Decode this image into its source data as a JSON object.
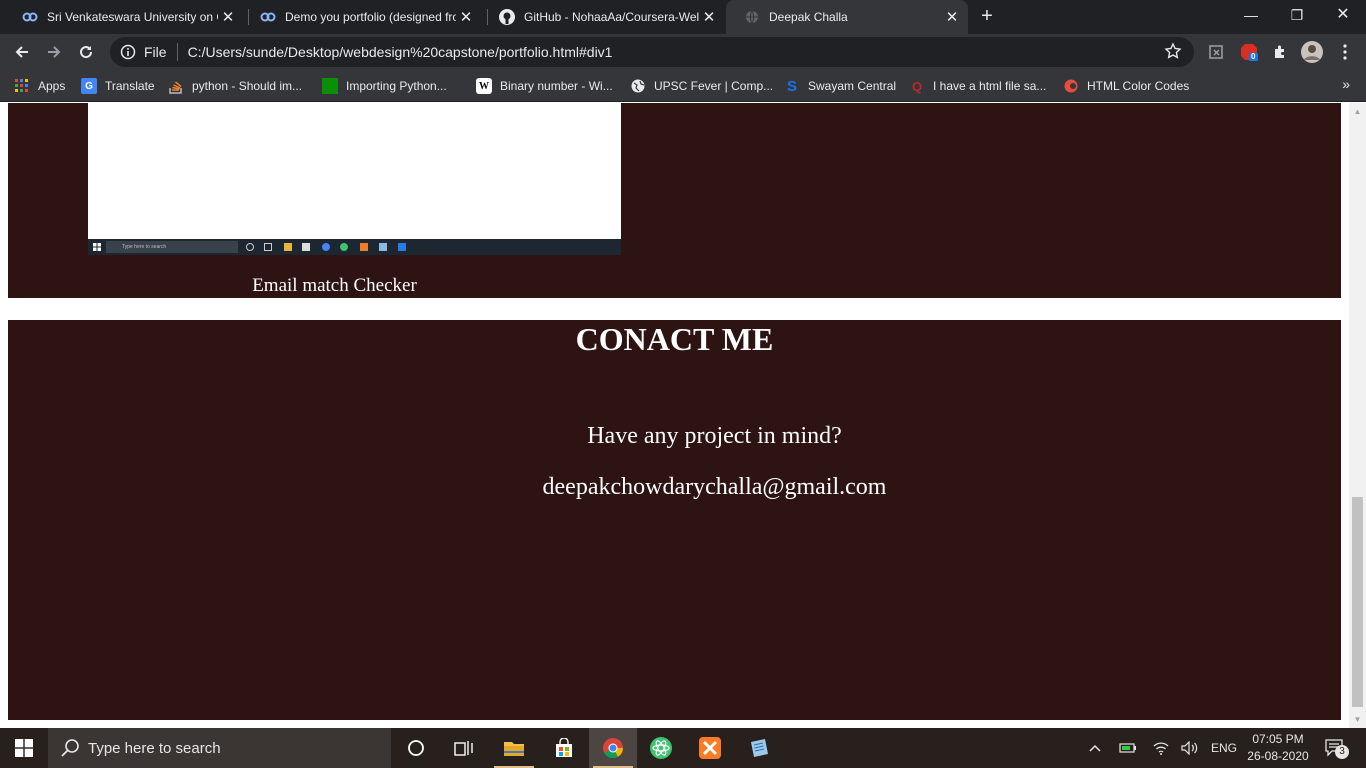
{
  "browser": {
    "tabs": [
      {
        "title": "Sri Venkateswara University on Co",
        "favicon": "coursera-icon",
        "active": false
      },
      {
        "title": "Demo you portfolio (designed fro",
        "favicon": "coursera-icon",
        "active": false
      },
      {
        "title": "GitHub - NohaaAa/Coursera-Wel",
        "favicon": "github-icon",
        "active": false
      },
      {
        "title": "Deepak Challa",
        "favicon": "globe-icon",
        "active": true
      }
    ],
    "new_tab_label": "+",
    "omnibox": {
      "scheme": "File",
      "url": "C:/Users/sunde/Desktop/webdesign%20capstone/portfolio.html#div1"
    },
    "extension_badge": "0",
    "bookmarks": [
      {
        "label": "Apps",
        "icon": "apps-grid-icon"
      },
      {
        "label": "Translate",
        "icon": "google-translate-icon"
      },
      {
        "label": "python - Should im...",
        "icon": "stackoverflow-icon"
      },
      {
        "label": "Importing Python...",
        "icon": "green-square-icon"
      },
      {
        "label": "Binary number - Wi...",
        "icon": "wikipedia-icon"
      },
      {
        "label": "UPSC Fever | Comp...",
        "icon": "globe-icon"
      },
      {
        "label": "Swayam Central",
        "icon": "swayam-icon"
      },
      {
        "label": "I have a html file sa...",
        "icon": "quora-icon"
      },
      {
        "label": "HTML Color Codes",
        "icon": "html-color-codes-icon"
      }
    ],
    "bookmarks_overflow": "»"
  },
  "page": {
    "project": {
      "caption": "Email match Checker",
      "mini_search_placeholder": "Type here to search"
    },
    "contact": {
      "title": "CONACT ME",
      "question": "Have any project in mind?",
      "email": "deepakchowdarychalla@gmail.com"
    }
  },
  "taskbar": {
    "search_placeholder": "Type here to search",
    "language": "ENG",
    "time": "07:05 PM",
    "date": "26-08-2020",
    "notification_count": "3"
  },
  "colors": {
    "section_bg": "#2e1313",
    "browser_dark": "#202124",
    "browser_toolbar": "#35363a",
    "taskbar_bg": "#28201c"
  }
}
